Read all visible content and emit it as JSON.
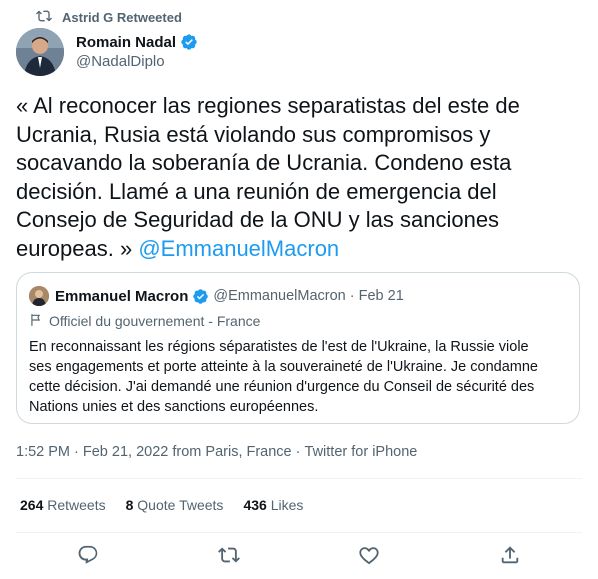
{
  "retweet": {
    "label": "Astrid G Retweeted",
    "icon": "retweet-icon"
  },
  "tweet": {
    "author_name": "Romain Nadal",
    "author_handle": "@NadalDiplo",
    "verified": true,
    "text": "« Al reconocer las regiones separatistas del este de\nUcrania, Rusia está violando sus compromisos y\nsocavando la soberanía de Ucrania. Condeno esta\ndecisión. Llamé a una reunión de emergencia del\nConsejo de Seguridad de la ONU y las sanciones\neuropeas. » ",
    "mention": "@EmmanuelMacron"
  },
  "quote": {
    "author_name": "Emmanuel Macron",
    "author_handle": "@EmmanuelMacron",
    "separator": "·",
    "date": "Feb 21",
    "label": "Officiel du gouvernement - France",
    "text": "En reconnaissant les régions séparatistes de l'est de l'Ukraine, la Russie viole\nses engagements et porte atteinte à la souveraineté de l'Ukraine. Je condamne\ncette décision. J'ai demandé une réunion d'urgence du Conseil de sécurité des\nNations unies et des sanctions européennes."
  },
  "meta": {
    "time": "1:52 PM",
    "sep1": " · ",
    "date": "Feb 21, 2022 from Paris, France",
    "sep2": " · ",
    "source": "Twitter for iPhone"
  },
  "stats": {
    "retweets_count": "264",
    "retweets_label": "Retweets",
    "quotes_count": "8",
    "quotes_label": "Quote Tweets",
    "likes_count": "436",
    "likes_label": "Likes"
  },
  "colors": {
    "link": "#1d9bf0",
    "secondary": "#536471",
    "border": "#cfd9de"
  }
}
